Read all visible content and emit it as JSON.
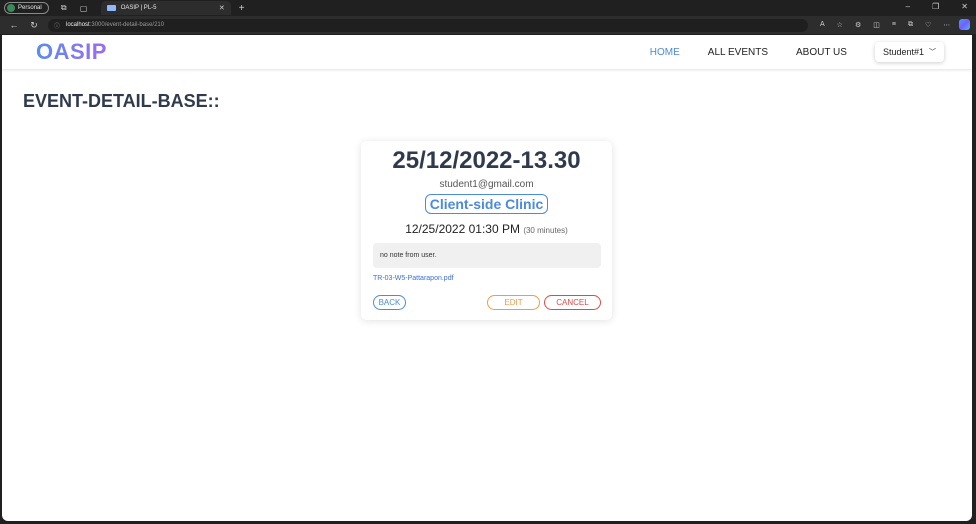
{
  "browser": {
    "profile_label": "Personal",
    "tab_title": "OASIP | PL-5",
    "url_host": "localhost",
    "url_path": ":3000/event-detail-base/210"
  },
  "site": {
    "logo": "OASIP",
    "nav": {
      "home": "HOME",
      "all_events": "ALL EVENTS",
      "about_us": "ABOUT US",
      "user": "Student#1"
    }
  },
  "page": {
    "heading": "EVENT-DETAIL-BASE::"
  },
  "event": {
    "date_title": "25/12/2022-13.30",
    "email": "student1@gmail.com",
    "category": "Client-side Clinic",
    "datetime": "12/25/2022 01:30 PM",
    "duration": "(30 minutes)",
    "note": "no note from user.",
    "file": "TR-03-W5-Pattarapon.pdf",
    "buttons": {
      "back": "BACK",
      "edit": "EDIT",
      "cancel": "CANCEL"
    }
  },
  "colors": {
    "accent": "#4a8ae0",
    "edit": "#f29a4a",
    "cancel": "#e04848",
    "heading": "#2f3a4c"
  }
}
